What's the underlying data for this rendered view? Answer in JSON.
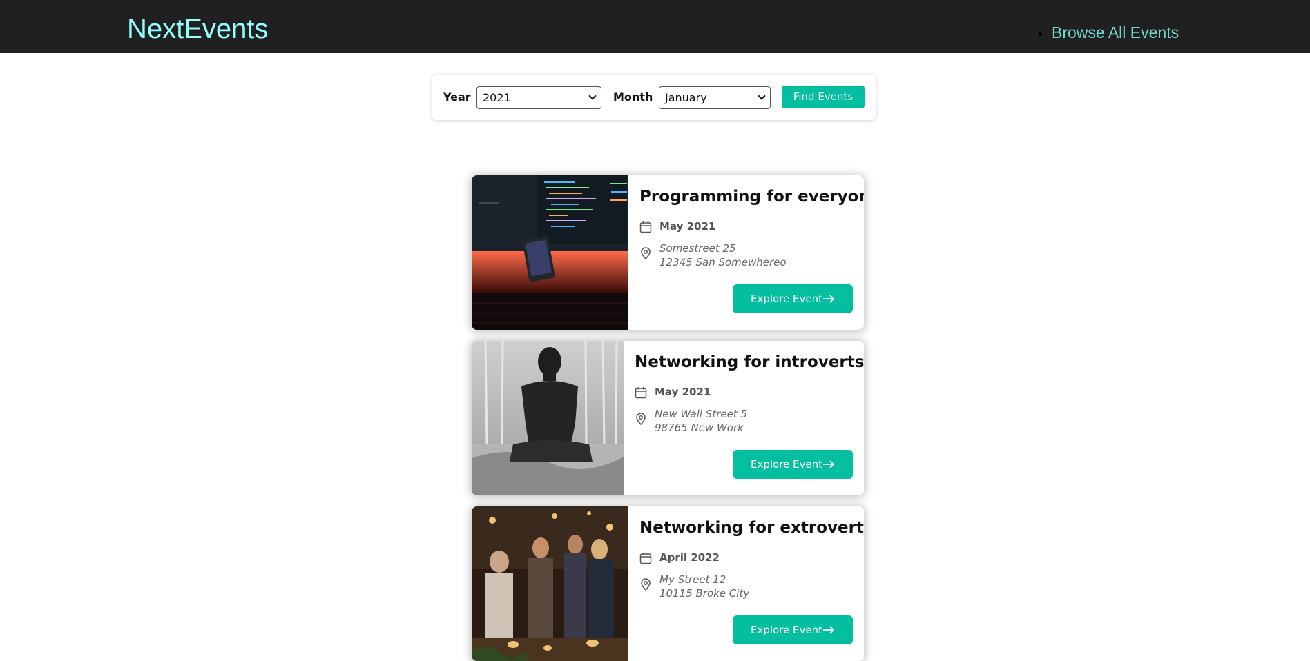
{
  "header": {
    "logo": "NextEvents",
    "nav_link": "Browse All Events"
  },
  "search": {
    "year_label": "Year",
    "year_value": "2021",
    "month_label": "Month",
    "month_value": "January",
    "find_label": "Find Events"
  },
  "events": [
    {
      "title": "Programming for everyone",
      "date": "May 2021",
      "address_line1": "Somestreet 25",
      "address_line2": "12345 San Somewhereo",
      "button": "Explore Event"
    },
    {
      "title": "Networking for introverts",
      "date": "May 2021",
      "address_line1": "New Wall Street 5",
      "address_line2": "98765 New Work",
      "button": "Explore Event"
    },
    {
      "title": "Networking for extroverts",
      "date": "April 2022",
      "address_line1": "My Street 12",
      "address_line2": "10115 Broke City",
      "button": "Explore Event"
    }
  ],
  "icons": {
    "date": "calendar-icon",
    "address": "location-pin-icon",
    "button": "arrow-right-icon"
  },
  "colors": {
    "header_bg": "#202020",
    "logo": "#94fdfd",
    "nav_link": "#74dacc",
    "accent": "#03be9f"
  }
}
